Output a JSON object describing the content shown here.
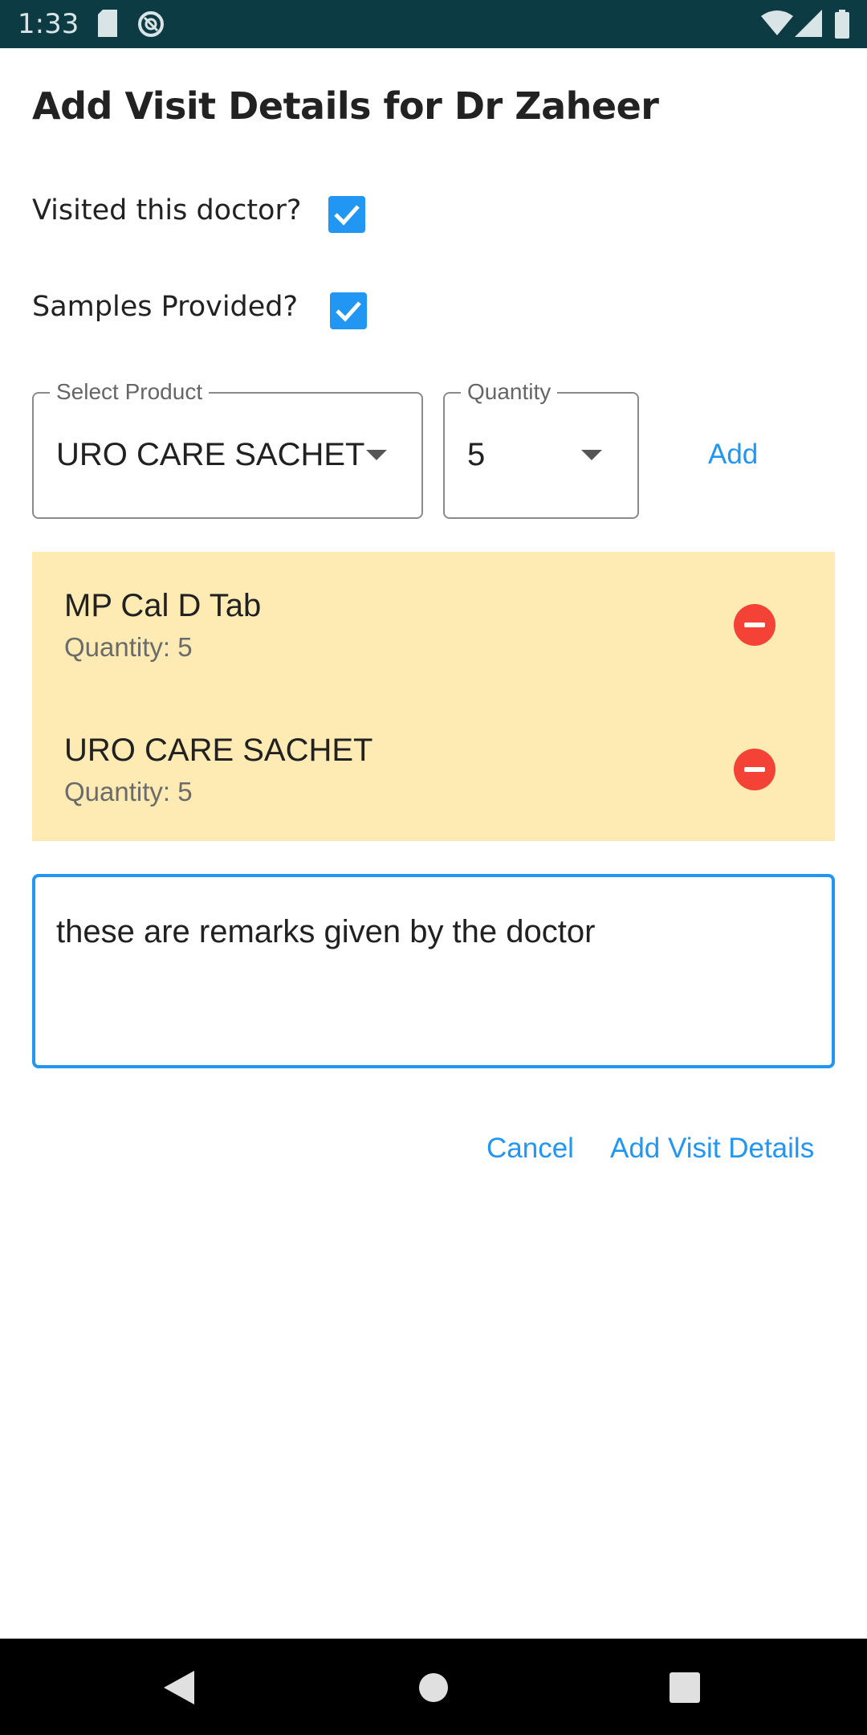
{
  "status_bar": {
    "time": "1:33"
  },
  "dialog": {
    "title": "Add Visit Details for Dr Zaheer",
    "visited_label": "Visited this doctor?",
    "visited_checked": true,
    "samples_label": "Samples Provided?",
    "samples_checked": true,
    "product_select": {
      "label": "Select Product",
      "value": "URO CARE SACHET"
    },
    "quantity_select": {
      "label": "Quantity",
      "value": "5"
    },
    "add_label": "Add",
    "items": [
      {
        "name": "MP Cal D Tab",
        "quantity": "Quantity: 5"
      },
      {
        "name": "URO CARE SACHET",
        "quantity": "Quantity: 5"
      }
    ],
    "remarks": "these are remarks given by the doctor",
    "cancel_label": "Cancel",
    "submit_label": "Add Visit Details"
  },
  "colors": {
    "accent": "#2196f3",
    "item_background": "#fdebb3",
    "remove": "#f44336",
    "status_bar": "#0c3b43"
  }
}
